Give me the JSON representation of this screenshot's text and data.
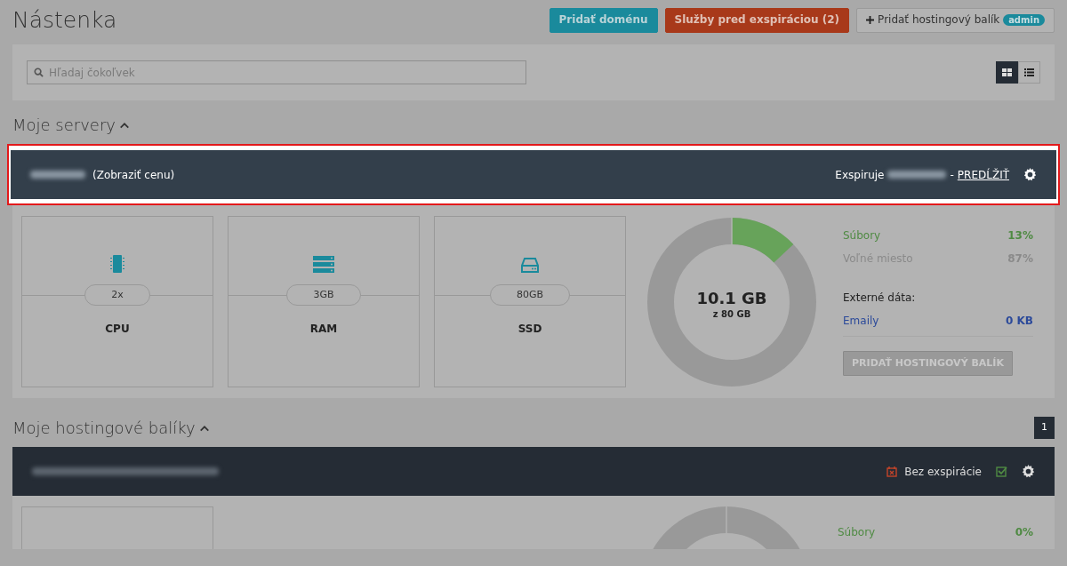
{
  "page": {
    "title": "Nástenka"
  },
  "header_buttons": [
    {
      "label": "Pridať doménu",
      "kind": "info"
    },
    {
      "label": "Služby pred exspiráciou (2)",
      "kind": "danger"
    },
    {
      "label": "Pridať hostingový balík",
      "kind": "add",
      "badge": "admin"
    }
  ],
  "search": {
    "placeholder": "Hľadaj čokoľvek"
  },
  "view_toggle": [
    {
      "kind": "grid",
      "selected": true
    },
    {
      "kind": "list",
      "selected": false
    }
  ],
  "servers": {
    "title": "Moje servery",
    "expanded": true,
    "card": {
      "highlighted": true,
      "price_link": "(Zobraziť cenu)",
      "expires_label": "Exspiruje",
      "separator": "-",
      "renew_link": "PREDĹŽIŤ",
      "resources": [
        {
          "kind": "cpu",
          "value": "2x",
          "label": "CPU"
        },
        {
          "kind": "ram",
          "value": "3GB",
          "label": "RAM"
        },
        {
          "kind": "ssd",
          "value": "80GB",
          "label": "SSD"
        }
      ],
      "usage": {
        "total": "10.1 GB",
        "of": "z 80 GB"
      },
      "stats": [
        {
          "label": "Súbory",
          "value": "13%",
          "kind": "used"
        },
        {
          "label": "Voľné miesto",
          "value": "87%",
          "kind": "free"
        }
      ],
      "external_title": "Externé dáta:",
      "external": [
        {
          "label": "Emaily",
          "value": "0 KB"
        }
      ],
      "action": {
        "label": "PRIDAŤ HOSTINGOVÝ BALÍK",
        "disabled": true
      }
    }
  },
  "packages": {
    "title": "Moje hostingové balíky",
    "expanded": true,
    "count": "1",
    "card": {
      "highlighted": false,
      "expiry": "Bez exspirácie",
      "checked": true,
      "stats": [
        {
          "label": "Súbory",
          "value": "0%",
          "kind": "used"
        }
      ]
    }
  }
}
